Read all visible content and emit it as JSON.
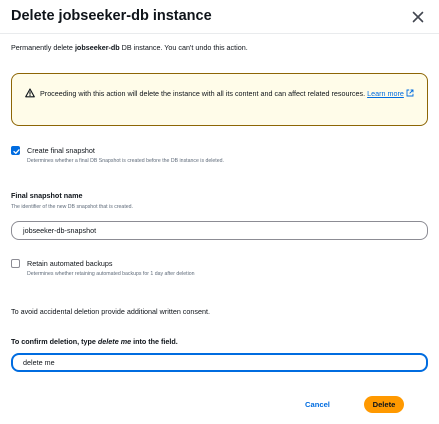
{
  "dialog": {
    "title": "Delete jobseeker-db instance",
    "description": {
      "prefix": "Permanently delete ",
      "instance_name": "jobseeker-db",
      "suffix": " DB instance. You can't undo this action."
    },
    "warning": {
      "text": "Proceeding with this action will delete the instance with all its content and can affect related resources.",
      "link_label": "Learn more",
      "icon": "warning-icon",
      "link_icon": "external-link-icon"
    },
    "final_snapshot": {
      "checked": true,
      "label": "Create final snapshot",
      "description": "Determines whether a final DB Snapshot is created before the DB instance is deleted."
    },
    "snapshot_name": {
      "label": "Final snapshot name",
      "description": "The identifier of the new DB snapshot that is created.",
      "value": "jobseeker-db-snapshot"
    },
    "retain_backups": {
      "checked": false,
      "label": "Retain automated backups",
      "description": "Determines whether retaining automated backups for 1 day after deletion"
    },
    "consent_text": "To avoid accidental deletion provide additional written consent.",
    "confirm": {
      "label_prefix": "To confirm deletion, type ",
      "label_keyword": "delete me",
      "label_suffix": " into the field.",
      "value": "delete me"
    },
    "buttons": {
      "cancel": "Cancel",
      "delete": "Delete"
    }
  },
  "colors": {
    "primary": "#006ce0",
    "delete_button": "#ff9900",
    "warning_border": "#8d6605",
    "warning_bg": "#fffce9"
  }
}
